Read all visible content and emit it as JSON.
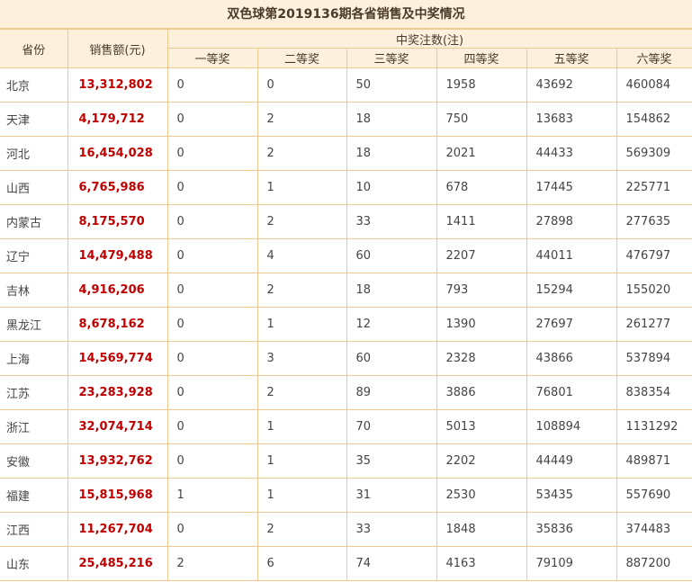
{
  "title": "双色球第2019136期各省销售及中奖情况",
  "headers": {
    "province": "省份",
    "sales": "销售额(元)",
    "winners_group": "中奖注数(注)",
    "prizes": [
      "一等奖",
      "二等奖",
      "三等奖",
      "四等奖",
      "五等奖",
      "六等奖"
    ]
  },
  "rows": [
    {
      "province": "北京",
      "sales": "13,312,802",
      "p": [
        "0",
        "0",
        "50",
        "1958",
        "43692",
        "460084"
      ]
    },
    {
      "province": "天津",
      "sales": "4,179,712",
      "p": [
        "0",
        "2",
        "18",
        "750",
        "13683",
        "154862"
      ]
    },
    {
      "province": "河北",
      "sales": "16,454,028",
      "p": [
        "0",
        "2",
        "18",
        "2021",
        "44433",
        "569309"
      ]
    },
    {
      "province": "山西",
      "sales": "6,765,986",
      "p": [
        "0",
        "1",
        "10",
        "678",
        "17445",
        "225771"
      ]
    },
    {
      "province": "内蒙古",
      "sales": "8,175,570",
      "p": [
        "0",
        "2",
        "33",
        "1411",
        "27898",
        "277635"
      ]
    },
    {
      "province": "辽宁",
      "sales": "14,479,488",
      "p": [
        "0",
        "4",
        "60",
        "2207",
        "44011",
        "476797"
      ]
    },
    {
      "province": "吉林",
      "sales": "4,916,206",
      "p": [
        "0",
        "2",
        "18",
        "793",
        "15294",
        "155020"
      ]
    },
    {
      "province": "黑龙江",
      "sales": "8,678,162",
      "p": [
        "0",
        "1",
        "12",
        "1390",
        "27697",
        "261277"
      ]
    },
    {
      "province": "上海",
      "sales": "14,569,774",
      "p": [
        "0",
        "3",
        "60",
        "2328",
        "43866",
        "537894"
      ]
    },
    {
      "province": "江苏",
      "sales": "23,283,928",
      "p": [
        "0",
        "2",
        "89",
        "3886",
        "76801",
        "838354"
      ]
    },
    {
      "province": "浙江",
      "sales": "32,074,714",
      "p": [
        "0",
        "1",
        "70",
        "5013",
        "108894",
        "1131292"
      ]
    },
    {
      "province": "安徽",
      "sales": "13,932,762",
      "p": [
        "0",
        "1",
        "35",
        "2202",
        "44449",
        "489871"
      ]
    },
    {
      "province": "福建",
      "sales": "15,815,968",
      "p": [
        "1",
        "1",
        "31",
        "2530",
        "53435",
        "557690"
      ]
    },
    {
      "province": "江西",
      "sales": "11,267,704",
      "p": [
        "0",
        "2",
        "33",
        "1848",
        "35836",
        "374483"
      ]
    },
    {
      "province": "山东",
      "sales": "25,485,216",
      "p": [
        "2",
        "6",
        "74",
        "4163",
        "79109",
        "887200"
      ]
    }
  ]
}
